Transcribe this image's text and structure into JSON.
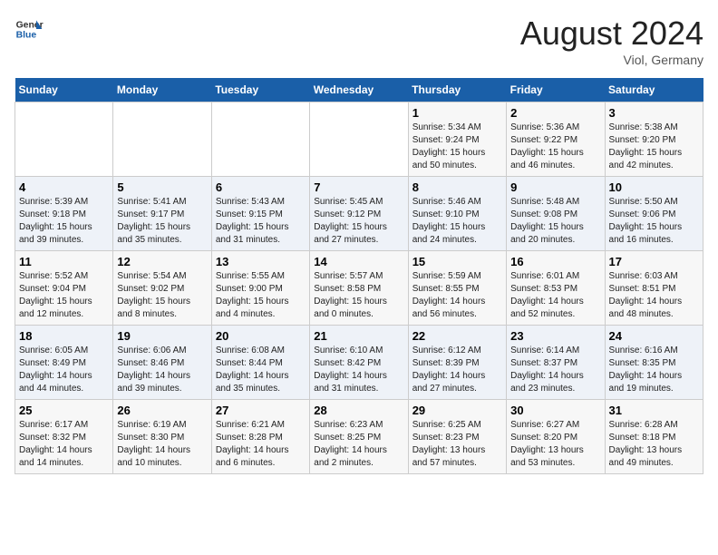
{
  "header": {
    "logo_general": "General",
    "logo_blue": "Blue",
    "month_year": "August 2024",
    "location": "Viol, Germany"
  },
  "days_of_week": [
    "Sunday",
    "Monday",
    "Tuesday",
    "Wednesday",
    "Thursday",
    "Friday",
    "Saturday"
  ],
  "weeks": [
    [
      {
        "day": "",
        "content": ""
      },
      {
        "day": "",
        "content": ""
      },
      {
        "day": "",
        "content": ""
      },
      {
        "day": "",
        "content": ""
      },
      {
        "day": "1",
        "content": "Sunrise: 5:34 AM\nSunset: 9:24 PM\nDaylight: 15 hours\nand 50 minutes."
      },
      {
        "day": "2",
        "content": "Sunrise: 5:36 AM\nSunset: 9:22 PM\nDaylight: 15 hours\nand 46 minutes."
      },
      {
        "day": "3",
        "content": "Sunrise: 5:38 AM\nSunset: 9:20 PM\nDaylight: 15 hours\nand 42 minutes."
      }
    ],
    [
      {
        "day": "4",
        "content": "Sunrise: 5:39 AM\nSunset: 9:18 PM\nDaylight: 15 hours\nand 39 minutes."
      },
      {
        "day": "5",
        "content": "Sunrise: 5:41 AM\nSunset: 9:17 PM\nDaylight: 15 hours\nand 35 minutes."
      },
      {
        "day": "6",
        "content": "Sunrise: 5:43 AM\nSunset: 9:15 PM\nDaylight: 15 hours\nand 31 minutes."
      },
      {
        "day": "7",
        "content": "Sunrise: 5:45 AM\nSunset: 9:12 PM\nDaylight: 15 hours\nand 27 minutes."
      },
      {
        "day": "8",
        "content": "Sunrise: 5:46 AM\nSunset: 9:10 PM\nDaylight: 15 hours\nand 24 minutes."
      },
      {
        "day": "9",
        "content": "Sunrise: 5:48 AM\nSunset: 9:08 PM\nDaylight: 15 hours\nand 20 minutes."
      },
      {
        "day": "10",
        "content": "Sunrise: 5:50 AM\nSunset: 9:06 PM\nDaylight: 15 hours\nand 16 minutes."
      }
    ],
    [
      {
        "day": "11",
        "content": "Sunrise: 5:52 AM\nSunset: 9:04 PM\nDaylight: 15 hours\nand 12 minutes."
      },
      {
        "day": "12",
        "content": "Sunrise: 5:54 AM\nSunset: 9:02 PM\nDaylight: 15 hours\nand 8 minutes."
      },
      {
        "day": "13",
        "content": "Sunrise: 5:55 AM\nSunset: 9:00 PM\nDaylight: 15 hours\nand 4 minutes."
      },
      {
        "day": "14",
        "content": "Sunrise: 5:57 AM\nSunset: 8:58 PM\nDaylight: 15 hours\nand 0 minutes."
      },
      {
        "day": "15",
        "content": "Sunrise: 5:59 AM\nSunset: 8:55 PM\nDaylight: 14 hours\nand 56 minutes."
      },
      {
        "day": "16",
        "content": "Sunrise: 6:01 AM\nSunset: 8:53 PM\nDaylight: 14 hours\nand 52 minutes."
      },
      {
        "day": "17",
        "content": "Sunrise: 6:03 AM\nSunset: 8:51 PM\nDaylight: 14 hours\nand 48 minutes."
      }
    ],
    [
      {
        "day": "18",
        "content": "Sunrise: 6:05 AM\nSunset: 8:49 PM\nDaylight: 14 hours\nand 44 minutes."
      },
      {
        "day": "19",
        "content": "Sunrise: 6:06 AM\nSunset: 8:46 PM\nDaylight: 14 hours\nand 39 minutes."
      },
      {
        "day": "20",
        "content": "Sunrise: 6:08 AM\nSunset: 8:44 PM\nDaylight: 14 hours\nand 35 minutes."
      },
      {
        "day": "21",
        "content": "Sunrise: 6:10 AM\nSunset: 8:42 PM\nDaylight: 14 hours\nand 31 minutes."
      },
      {
        "day": "22",
        "content": "Sunrise: 6:12 AM\nSunset: 8:39 PM\nDaylight: 14 hours\nand 27 minutes."
      },
      {
        "day": "23",
        "content": "Sunrise: 6:14 AM\nSunset: 8:37 PM\nDaylight: 14 hours\nand 23 minutes."
      },
      {
        "day": "24",
        "content": "Sunrise: 6:16 AM\nSunset: 8:35 PM\nDaylight: 14 hours\nand 19 minutes."
      }
    ],
    [
      {
        "day": "25",
        "content": "Sunrise: 6:17 AM\nSunset: 8:32 PM\nDaylight: 14 hours\nand 14 minutes."
      },
      {
        "day": "26",
        "content": "Sunrise: 6:19 AM\nSunset: 8:30 PM\nDaylight: 14 hours\nand 10 minutes."
      },
      {
        "day": "27",
        "content": "Sunrise: 6:21 AM\nSunset: 8:28 PM\nDaylight: 14 hours\nand 6 minutes."
      },
      {
        "day": "28",
        "content": "Sunrise: 6:23 AM\nSunset: 8:25 PM\nDaylight: 14 hours\nand 2 minutes."
      },
      {
        "day": "29",
        "content": "Sunrise: 6:25 AM\nSunset: 8:23 PM\nDaylight: 13 hours\nand 57 minutes."
      },
      {
        "day": "30",
        "content": "Sunrise: 6:27 AM\nSunset: 8:20 PM\nDaylight: 13 hours\nand 53 minutes."
      },
      {
        "day": "31",
        "content": "Sunrise: 6:28 AM\nSunset: 8:18 PM\nDaylight: 13 hours\nand 49 minutes."
      }
    ]
  ]
}
